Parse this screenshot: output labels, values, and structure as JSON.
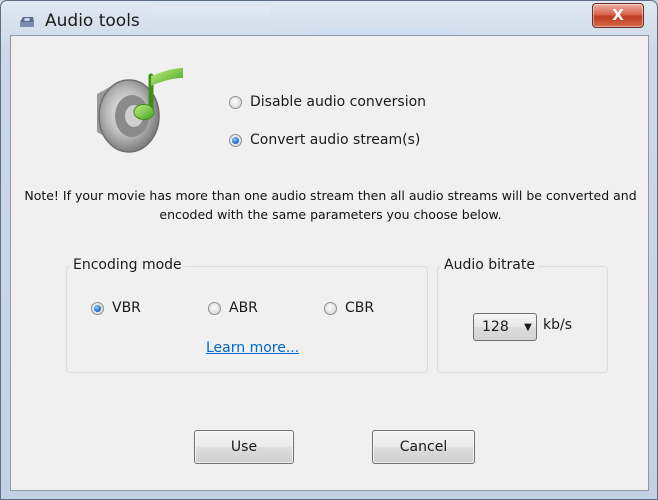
{
  "window": {
    "title": "Audio tools",
    "close_glyph": "X",
    "icon": "speaker-app-icon",
    "close_color": "#c6412a"
  },
  "conversion": {
    "options": [
      {
        "label": "Disable audio conversion",
        "checked": false
      },
      {
        "label": "Convert audio stream(s)",
        "checked": true
      }
    ]
  },
  "note": {
    "line1": "Note! If your movie has more than one audio stream then all audio streams will be converted and",
    "line2": "encoded with the same parameters you choose below."
  },
  "encoding_mode": {
    "legend": "Encoding mode",
    "options": [
      {
        "label": "VBR",
        "checked": true
      },
      {
        "label": "ABR",
        "checked": false
      },
      {
        "label": "CBR",
        "checked": false
      }
    ],
    "learn_more": "Learn more..."
  },
  "audio_bitrate": {
    "legend": "Audio bitrate",
    "value": "128",
    "unit": "kb/s"
  },
  "buttons": {
    "use": "Use",
    "cancel": "Cancel"
  },
  "colors": {
    "link": "#0066cc",
    "radio_selected": "#1d6fd1",
    "dialog_bg": "#f0f0f0"
  }
}
